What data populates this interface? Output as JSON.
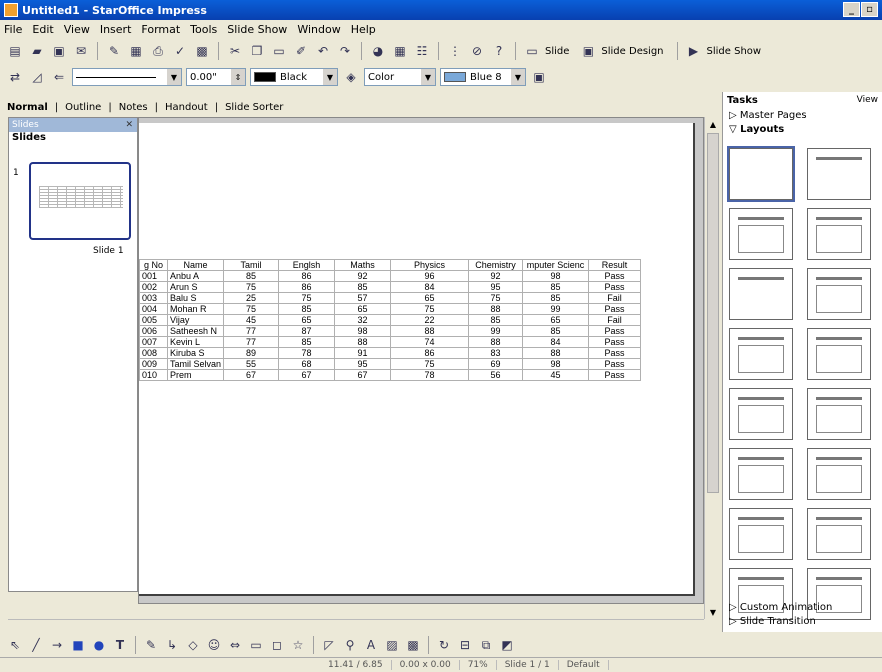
{
  "window": {
    "title": "Untitled1 - StarOffice Impress"
  },
  "menu": [
    "File",
    "Edit",
    "View",
    "Insert",
    "Format",
    "Tools",
    "Slide Show",
    "Window",
    "Help"
  ],
  "toolbar1": {
    "slide_label": "Slide",
    "slide_design_label": "Slide Design",
    "slide_show_label": "Slide Show"
  },
  "toolbar2": {
    "line_width": "0.00\"",
    "line_color": "Black",
    "fill_mode": "Color",
    "fill_color": "Blue 8"
  },
  "view_tabs": [
    "Normal",
    "Outline",
    "Notes",
    "Handout",
    "Slide Sorter"
  ],
  "slides_pane": {
    "header": "Slides",
    "title": "Slides",
    "slide_number": "1",
    "slide_label": "Slide 1"
  },
  "table": {
    "headers": [
      "g No",
      "Name",
      "Tamil",
      "Englsh",
      "Maths",
      "Physics",
      "Chemistry",
      "mputer Scienc",
      "Result"
    ],
    "rows": [
      [
        "001",
        "Anbu A",
        "85",
        "86",
        "92",
        "96",
        "92",
        "98",
        "Pass"
      ],
      [
        "002",
        "Arun S",
        "75",
        "86",
        "85",
        "84",
        "95",
        "85",
        "Pass"
      ],
      [
        "003",
        "Balu S",
        "25",
        "75",
        "57",
        "65",
        "75",
        "85",
        "Fail"
      ],
      [
        "004",
        "Mohan R",
        "75",
        "85",
        "65",
        "75",
        "88",
        "99",
        "Pass"
      ],
      [
        "005",
        "Vijay",
        "45",
        "65",
        "32",
        "22",
        "85",
        "65",
        "Fail"
      ],
      [
        "006",
        "Satheesh N",
        "77",
        "87",
        "98",
        "88",
        "99",
        "85",
        "Pass"
      ],
      [
        "007",
        "Kevin L",
        "77",
        "85",
        "88",
        "74",
        "88",
        "84",
        "Pass"
      ],
      [
        "008",
        "Kiruba S",
        "89",
        "78",
        "91",
        "86",
        "83",
        "88",
        "Pass"
      ],
      [
        "009",
        "Tamil Selvan",
        "55",
        "68",
        "95",
        "75",
        "69",
        "98",
        "Pass"
      ],
      [
        "010",
        "Prem",
        "67",
        "67",
        "67",
        "78",
        "56",
        "45",
        "Pass"
      ]
    ]
  },
  "tasks": {
    "title": "Tasks",
    "view": "View",
    "master_pages": "Master Pages",
    "layouts": "Layouts",
    "custom_animation": "Custom Animation",
    "slide_transition": "Slide Transition"
  },
  "status": {
    "position": "11.41 / 6.85",
    "size": "0.00 x 0.00",
    "zoom": "71%",
    "slide": "Slide 1 / 1",
    "master": "Default"
  }
}
